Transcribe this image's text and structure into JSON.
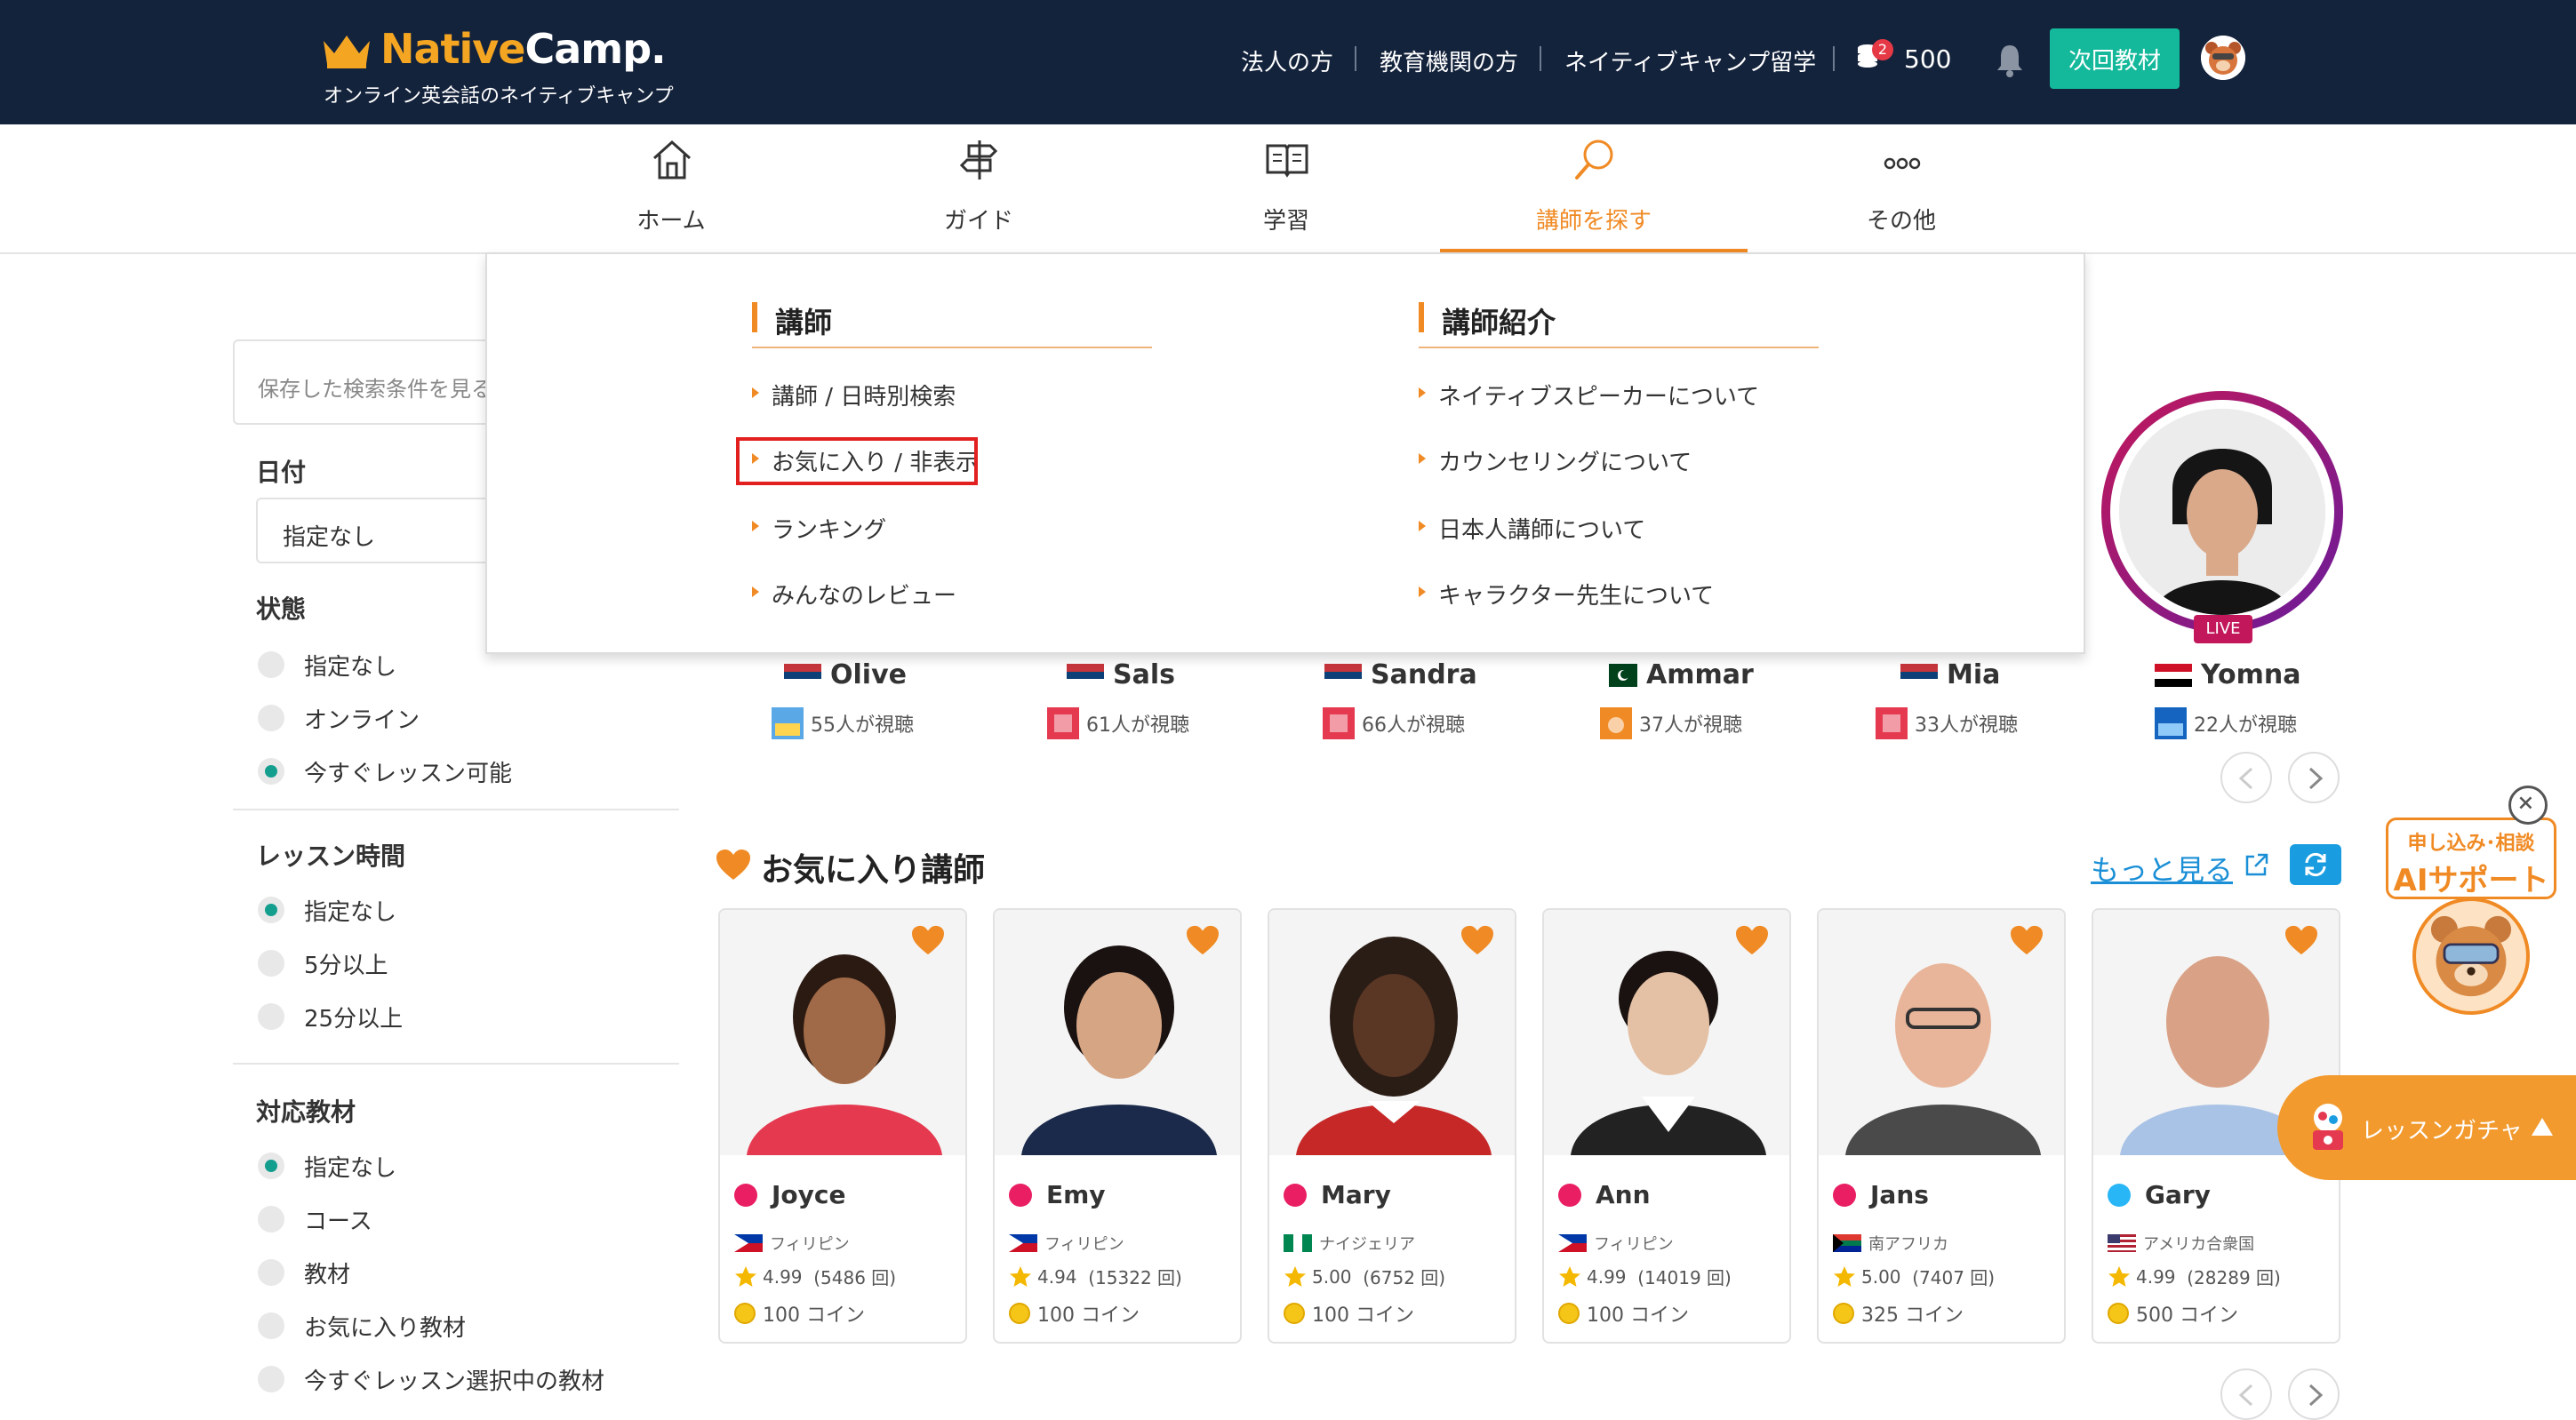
{
  "header": {
    "logo_prefix": "Native",
    "logo_suffix": "Camp.",
    "logo_sub": "オンライン英会話のネイティブキャンプ",
    "links": [
      "法人の方",
      "教育機関の方",
      "ネイティブキャンプ留学"
    ],
    "coin_badge": "2",
    "coin_count": "500",
    "next_button": "次回教材"
  },
  "nav": {
    "items": [
      {
        "label": "ホーム",
        "icon": "home-icon"
      },
      {
        "label": "ガイド",
        "icon": "signpost-icon"
      },
      {
        "label": "学習",
        "icon": "book-icon"
      },
      {
        "label": "講師を探す",
        "icon": "search-icon",
        "active": true
      },
      {
        "label": "その他",
        "icon": "more-icon"
      }
    ]
  },
  "dropdown": {
    "col1": {
      "heading": "講師",
      "items": [
        "講師 / 日時別検索",
        "お気に入り / 非表示",
        "ランキング",
        "みんなのレビュー"
      ]
    },
    "col2": {
      "heading": "講師紹介",
      "items": [
        "ネイティブスピーカーについて",
        "カウンセリングについて",
        "日本人講師について",
        "キャラクター先生について"
      ]
    }
  },
  "sidebar": {
    "saved_search": "保存した検索条件を見る",
    "date_label": "日付",
    "date_value": "指定なし",
    "status_label": "状態",
    "status_options": [
      "指定なし",
      "オンライン",
      "今すぐレッスン可能"
    ],
    "lesson_time_label": "レッスン時間",
    "lesson_time_options": [
      "指定なし",
      "5分以上",
      "25分以上"
    ],
    "material_label": "対応教材",
    "material_options": [
      "指定なし",
      "コース",
      "教材",
      "お気に入り教材",
      "今すぐレッスン選択中の教材"
    ]
  },
  "live": {
    "badge": "LIVE",
    "teachers": [
      {
        "name": "Olive",
        "viewers": "55人が視聴"
      },
      {
        "name": "Sals",
        "viewers": "61人が視聴"
      },
      {
        "name": "Sandra",
        "viewers": "66人が視聴"
      },
      {
        "name": "Ammar",
        "viewers": "37人が視聴"
      },
      {
        "name": "Mia",
        "viewers": "33人が視聴"
      },
      {
        "name": "Yomna",
        "viewers": "22人が視聴"
      }
    ]
  },
  "favorites": {
    "title": "お気に入り講師",
    "more_link": "もっと見る",
    "cards": [
      {
        "name": "Joyce",
        "country": "フィリピン",
        "rating": "4.99",
        "reviews": "(5486 回)",
        "coins": "100 コイン"
      },
      {
        "name": "Emy",
        "country": "フィリピン",
        "rating": "4.94",
        "reviews": "(15322 回)",
        "coins": "100 コイン"
      },
      {
        "name": "Mary",
        "country": "ナイジェリア",
        "rating": "5.00",
        "reviews": "(6752 回)",
        "coins": "100 コイン"
      },
      {
        "name": "Ann",
        "country": "フィリピン",
        "rating": "4.99",
        "reviews": "(14019 回)",
        "coins": "100 コイン"
      },
      {
        "name": "Jans",
        "country": "南アフリカ",
        "rating": "5.00",
        "reviews": "(7407 回)",
        "coins": "325 コイン"
      },
      {
        "name": "Gary",
        "country": "アメリカ合衆国",
        "rating": "4.99",
        "reviews": "(28289 回)",
        "coins": "500 コイン"
      }
    ]
  },
  "ai_support": {
    "line1": "申し込み･相談",
    "line2": "AIサポート"
  },
  "gacha": {
    "label": "レッスンガチャ"
  },
  "colors": {
    "header_bg": "#14233c",
    "accent_orange": "#f08a24",
    "teal": "#13b99a",
    "link_blue": "#1a8fd6"
  }
}
